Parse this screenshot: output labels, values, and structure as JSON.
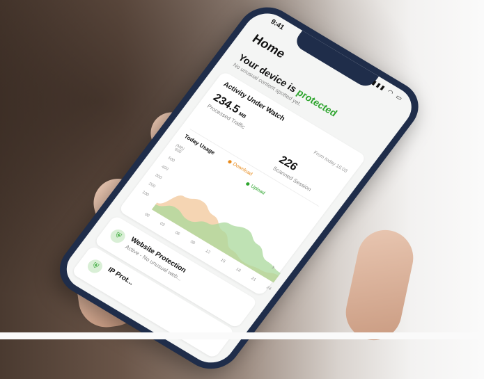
{
  "status_bar": {
    "time": "9:41",
    "icons": "▮▮▮ ◠ ▭"
  },
  "page": {
    "title": "Home"
  },
  "protection": {
    "heading_prefix": "Your device is ",
    "heading_highlight": "protected",
    "subtitle": "No unusual content spotted yet."
  },
  "activity": {
    "title": "Activity Under Watch",
    "traffic_value": "234.5",
    "traffic_unit": "MB",
    "traffic_label": "Processed Traffic",
    "since": "From today 16:03",
    "sessions_value": "226",
    "sessions_label": "Scanned Session"
  },
  "usage": {
    "title": "Today Usage",
    "legend_download": "Download",
    "legend_upload": "Upload",
    "y_unit": "(MB)"
  },
  "chart_data": {
    "type": "area",
    "title": "Today Usage",
    "ylabel": "(MB)",
    "x": [
      "00",
      "03",
      "06",
      "09",
      "12",
      "15",
      "18",
      "21",
      "24"
    ],
    "y_ticks": [
      100,
      200,
      300,
      400,
      500,
      600
    ],
    "ylim": [
      0,
      600
    ],
    "series": [
      {
        "name": "Download",
        "color": "#f2c79a",
        "values": [
          80,
          260,
          310,
          250,
          170,
          60,
          20,
          40,
          80
        ]
      },
      {
        "name": "Upload",
        "color": "#a9d89b",
        "values": [
          60,
          130,
          90,
          160,
          260,
          300,
          230,
          140,
          110
        ]
      }
    ]
  },
  "rows": [
    {
      "title": "Website Protection",
      "subtitle": "Active - No unusual web..."
    },
    {
      "title": "IP Prot...",
      "subtitle": ""
    }
  ],
  "colors": {
    "accent": "#2ea52e",
    "download": "#e88a1a",
    "frame": "#1f2d4a"
  },
  "icons": {
    "shield": "shield-icon",
    "chevron": "chevron-right-icon"
  }
}
